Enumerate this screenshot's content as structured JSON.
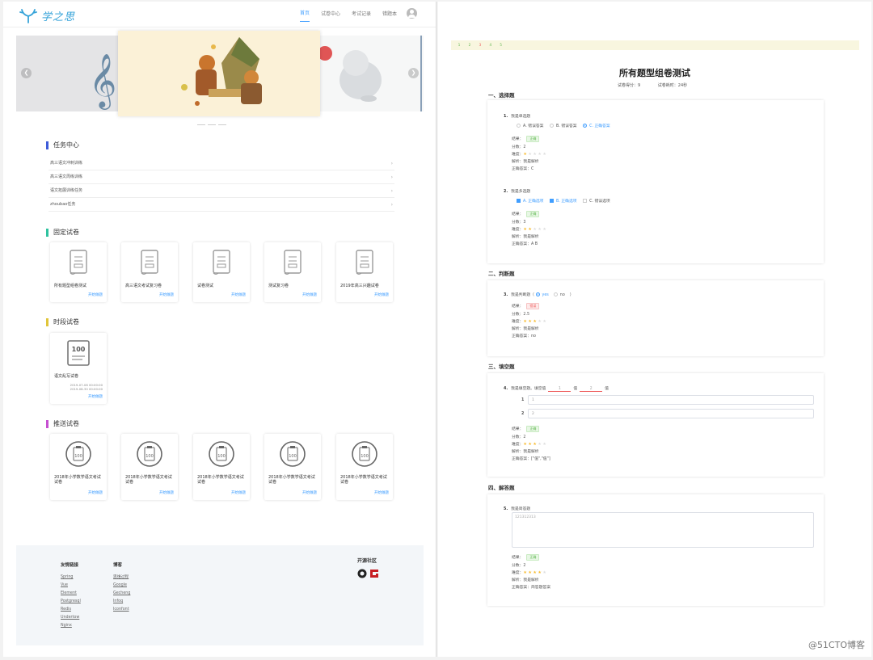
{
  "header": {
    "logo_text": "学之思",
    "nav": [
      "首页",
      "试卷中心",
      "考试记录",
      "错题本"
    ]
  },
  "sections": {
    "tasks": "任务中心",
    "fixed": "固定试卷",
    "timed": "时段试卷",
    "pushed": "推送试卷"
  },
  "tasks": [
    "高三语文冲刺训练",
    "高三语文周练训练",
    "语文拓展训练任务",
    "zhoubao任务"
  ],
  "fixed_papers": [
    "所有题型组卷测试",
    "高三语文考试复习卷",
    "试卷测试",
    "测试复习卷",
    "2019年高三兴趣试卷"
  ],
  "timed_paper": {
    "name": "语文乱写试卷",
    "start": "2019-07-08 00:00:00",
    "end": "2019-08-30 00:00:00"
  },
  "pushed_papers": [
    "2018年小学数学语文考试试卷",
    "2018年小学数学语文考试试卷",
    "2018年小学数学语文考试试卷",
    "2018年小学数学语文考试试卷",
    "2018年小学数学语文考试试卷"
  ],
  "start_label": "开始做题",
  "footer": {
    "links_title": "友情链接",
    "links": [
      "Spring",
      "Vue",
      "Element",
      "Postgresql",
      "Redis",
      "Undertow",
      "Nginx"
    ],
    "blog_title": "博客",
    "blogs": [
      "思维过程",
      "Google",
      "Gecheng",
      "Infoq",
      "Iconfont"
    ],
    "open_title": "开源社区"
  },
  "exam": {
    "pager": [
      "1",
      "2",
      "3",
      "4",
      "5"
    ],
    "title": "所有题型组卷测试",
    "score_label": "试卷得分：",
    "score": "9",
    "time_label": "试卷耗时：",
    "time": "24秒",
    "labels": {
      "result": "结果：",
      "score": "分数：",
      "difficulty": "难度：",
      "analysis": "解析：",
      "answer": "正确答案："
    },
    "sections": [
      "一、选择题",
      "二、判断题",
      "三、填空题",
      "四、解答题"
    ],
    "q1": {
      "num": "1.",
      "text": "我是单选题",
      "options": [
        [
          "A.",
          "错误答案"
        ],
        [
          "B.",
          "错误答案"
        ],
        [
          "C.",
          "正确答案"
        ]
      ],
      "result": "正确",
      "score": "2",
      "analysis": "我是解析",
      "answer": "C"
    },
    "q2": {
      "num": "2.",
      "text": "我是多选题",
      "options": [
        [
          "A.",
          "正确选项"
        ],
        [
          "B.",
          "正确选项"
        ],
        [
          "C.",
          "错误选项"
        ]
      ],
      "result": "正确",
      "score": "3",
      "analysis": "我是解析",
      "answer": "A B"
    },
    "q3": {
      "num": "3.",
      "text": "我是判断题（",
      "opt_yes": "yes",
      "opt_no": "no",
      "close": "）",
      "result": "错误",
      "score": "2.5",
      "analysis": "我是解析",
      "answer": "no"
    },
    "q4": {
      "num": "4.",
      "text": "我是填空题。填空值",
      "blank1": "1",
      "mid": "值",
      "blank2": "2",
      "tail": "值",
      "in1_label": "1",
      "in1": "1",
      "in2_label": "2",
      "in2": "2",
      "result": "正确",
      "score": "2",
      "analysis": "我是解析",
      "answer": "[\"值\",\"值\"]"
    },
    "q5": {
      "num": "5.",
      "text": "我是简答题",
      "value": "121312313",
      "result": "正确",
      "score": "2",
      "analysis": "我是解析",
      "answer": "简答题答案"
    }
  },
  "watermark": "@51CTO博客",
  "colors": {
    "accent": "#409eff",
    "task": "#3d5bd9",
    "fixed": "#2fc29f",
    "timed": "#e0c53a",
    "pushed": "#c64fd1"
  }
}
